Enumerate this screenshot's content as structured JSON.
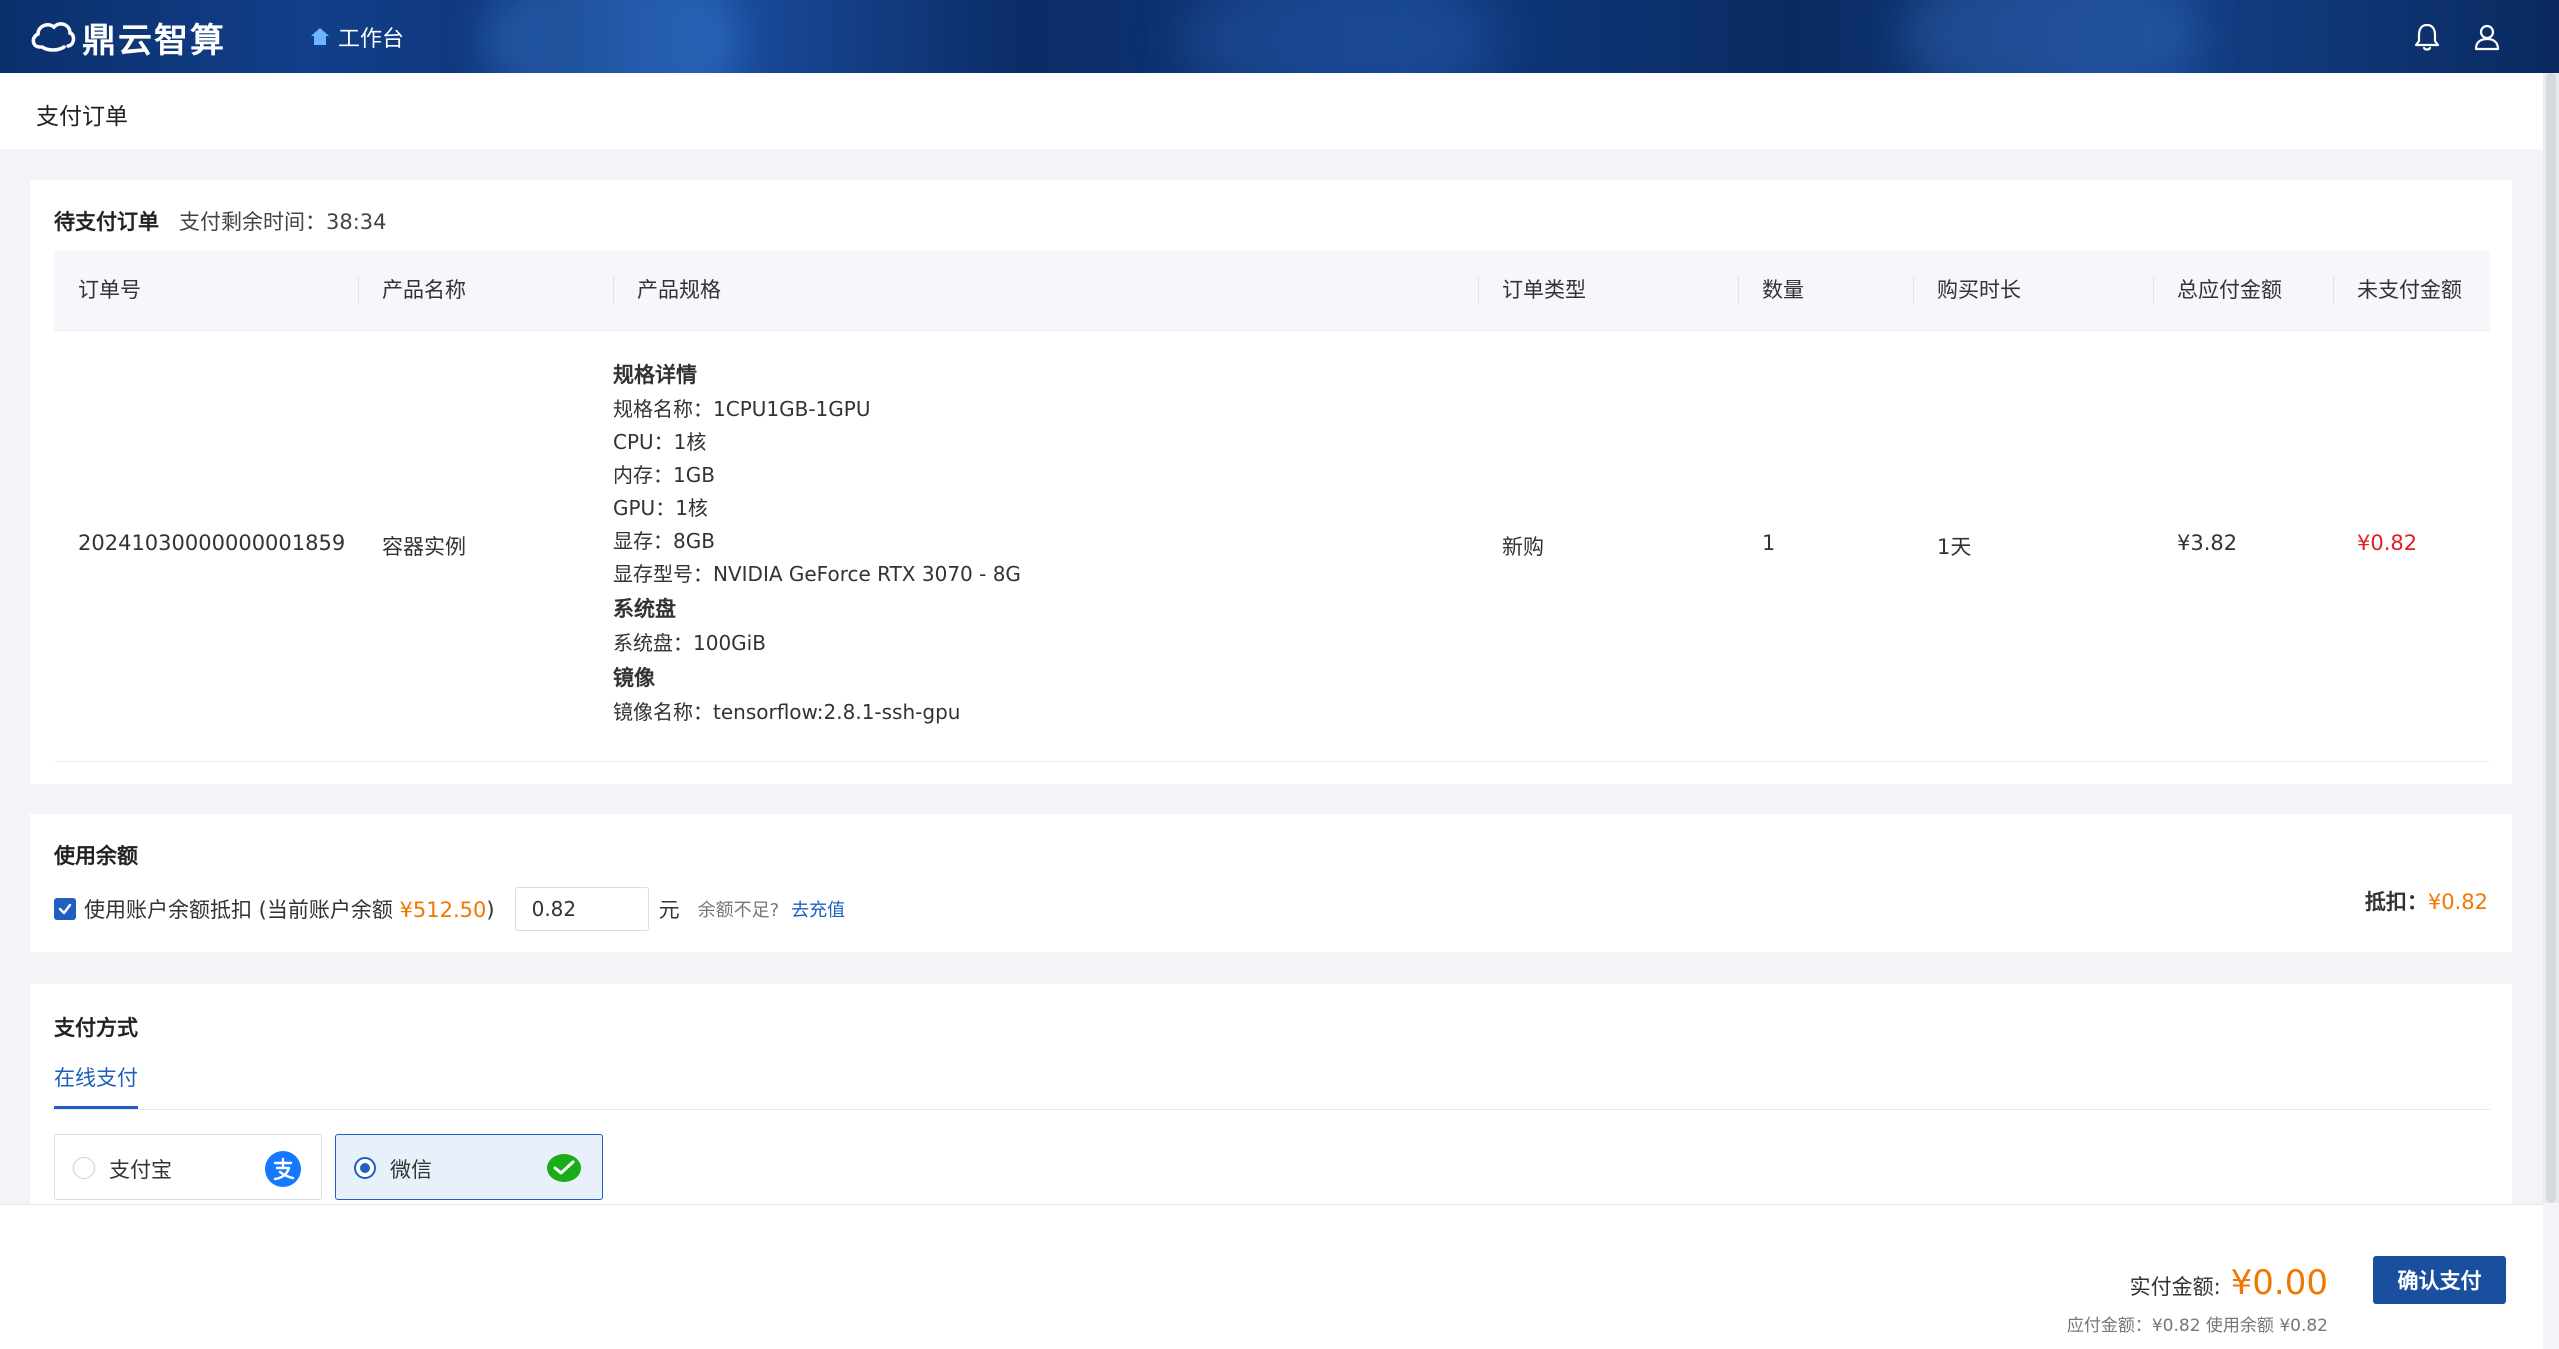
{
  "header": {
    "brand": "鼎云智算",
    "nav_workbench": "工作台"
  },
  "page": {
    "title": "支付订单"
  },
  "orders": {
    "section_title": "待支付订单",
    "countdown_label": "支付剩余时间：",
    "countdown_value": "38:34",
    "columns": [
      "订单号",
      "产品名称",
      "产品规格",
      "订单类型",
      "数量",
      "购买时长",
      "总应付金额",
      "未支付金额"
    ],
    "row": {
      "order_no": "20241030000000001859",
      "product_name": "容器实例",
      "spec": {
        "detail_title": "规格详情",
        "spec_name": "规格名称：1CPU1GB-1GPU",
        "cpu": "CPU：1核",
        "memory": "内存：1GB",
        "gpu": "GPU：1核",
        "vram": "显存：8GB",
        "gpu_model": "显存型号：NVIDIA GeForce RTX 3070 - 8G",
        "disk_title": "系统盘",
        "disk": "系统盘：100GiB",
        "image_title": "镜像",
        "image": "镜像名称：tensorflow:2.8.1-ssh-gpu"
      },
      "order_type": "新购",
      "quantity": "1",
      "duration": "1天",
      "total": "¥3.82",
      "unpaid": "¥0.82"
    }
  },
  "balance": {
    "title": "使用余额",
    "checkbox_label": "使用账户余额抵扣 (当前账户余额 ",
    "balance_amount": "¥512.50",
    "checkbox_label_end": ")",
    "input_value": "0.82",
    "unit": "元",
    "insufficient": "余额不足?",
    "recharge": "去充值",
    "deduct_label": "抵扣：",
    "deduct_value": "¥0.82",
    "checked": true
  },
  "payment": {
    "title": "支付方式",
    "tab": "在线支付",
    "options": [
      {
        "label": "支付宝",
        "icon": "alipay-icon",
        "selected": false
      },
      {
        "label": "微信",
        "icon": "wechat-pay-icon",
        "selected": true
      }
    ]
  },
  "footer": {
    "actual_label": "实付金额:",
    "actual_value": "¥0.00",
    "detail": "应付金额：¥0.82 使用余额 ¥0.82",
    "confirm": "确认支付"
  },
  "colors": {
    "primary": "#1f5fbf",
    "accent_orange": "#f07800",
    "unpaid_red": "#e02020"
  }
}
